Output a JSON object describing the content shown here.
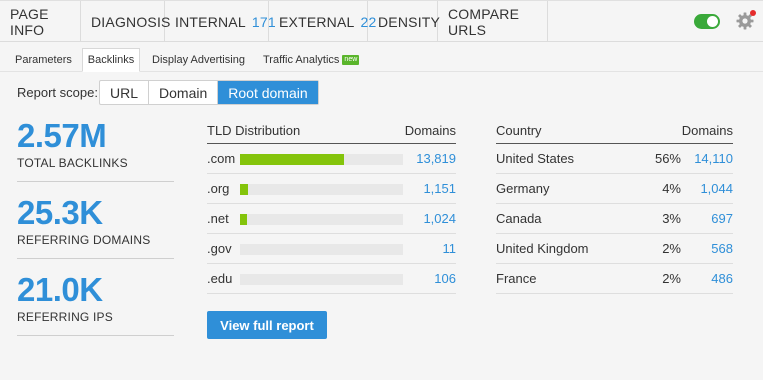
{
  "topnav": {
    "tabs": [
      {
        "label": "PAGE INFO",
        "count": ""
      },
      {
        "label": "DIAGNOSIS",
        "count": ""
      },
      {
        "label": "INTERNAL",
        "count": "171"
      },
      {
        "label": "EXTERNAL",
        "count": "22"
      },
      {
        "label": "DENSITY",
        "count": ""
      },
      {
        "label": "COMPARE URLS",
        "count": ""
      }
    ],
    "toggle_on": true,
    "accent": "#2f8fd8",
    "toggle_color": "#3aa93a",
    "notification_color": "#e52b2b"
  },
  "subnav": {
    "tabs": [
      "Parameters",
      "Backlinks",
      "Display Advertising",
      "Traffic Analytics"
    ],
    "new_badge": "new",
    "active": "Backlinks"
  },
  "scope": {
    "label": "Report scope:",
    "options": [
      "URL",
      "Domain",
      "Root domain"
    ],
    "selected": "Root domain"
  },
  "metrics": [
    {
      "value": "2.57M",
      "label": "TOTAL BACKLINKS"
    },
    {
      "value": "25.3K",
      "label": "REFERRING DOMAINS"
    },
    {
      "value": "21.0K",
      "label": "REFERRING IPS"
    }
  ],
  "tld": {
    "header_left": "TLD Distribution",
    "header_right": "Domains",
    "bar_color": "#84c40b",
    "rows": [
      {
        "name": ".com",
        "value": "13,819",
        "share": 0.64
      },
      {
        "name": ".org",
        "value": "1,151",
        "share": 0.05
      },
      {
        "name": ".net",
        "value": "1,024",
        "share": 0.045
      },
      {
        "name": ".gov",
        "value": "11",
        "share": 0
      },
      {
        "name": ".edu",
        "value": "106",
        "share": 0
      }
    ]
  },
  "country": {
    "header_left": "Country",
    "header_right": "Domains",
    "rows": [
      {
        "name": "United States",
        "pct": "56%",
        "value": "14,110"
      },
      {
        "name": "Germany",
        "pct": "4%",
        "value": "1,044"
      },
      {
        "name": "Canada",
        "pct": "3%",
        "value": "697"
      },
      {
        "name": "United Kingdom",
        "pct": "2%",
        "value": "568"
      },
      {
        "name": "France",
        "pct": "2%",
        "value": "486"
      }
    ]
  },
  "view_button": "View full report"
}
